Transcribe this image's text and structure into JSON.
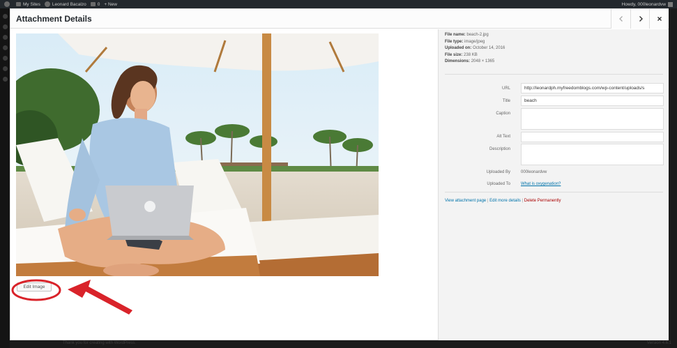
{
  "admin_bar": {
    "my_sites": "My Sites",
    "site_name": "Leonard Bacalzo",
    "comments_count": "0",
    "new_label": "+ New",
    "howdy": "Howdy, 000leonardvw"
  },
  "background": {
    "footer_left": "Thank you for creating with WordPress.",
    "footer_right": "Version 4.6.1"
  },
  "modal": {
    "title": "Attachment Details",
    "prev_icon": "chevron-left-icon",
    "next_icon": "chevron-right-icon",
    "close_icon": "close-icon"
  },
  "image": {
    "description": "Woman sitting cross-legged on a white beach lounger under a parasol, using a laptop, palm trees in background"
  },
  "edit_image_label": "Edit Image",
  "file_info": [
    {
      "label": "File name:",
      "value": "beach-2.jpg"
    },
    {
      "label": "File type:",
      "value": "image/jpeg"
    },
    {
      "label": "Uploaded on:",
      "value": "October 14, 2016"
    },
    {
      "label": "File size:",
      "value": "238 KB"
    },
    {
      "label": "Dimensions:",
      "value": "2048 × 1365"
    }
  ],
  "fields": {
    "url": {
      "label": "URL",
      "value": "http://leonardph.myfreedomblogs.com/wp-content/uploads/s"
    },
    "title": {
      "label": "Title",
      "value": "beach"
    },
    "caption": {
      "label": "Caption",
      "value": ""
    },
    "alt_text": {
      "label": "Alt Text",
      "value": ""
    },
    "description": {
      "label": "Description",
      "value": ""
    },
    "uploaded_by": {
      "label": "Uploaded By",
      "value": "000leonardvw"
    },
    "uploaded_to": {
      "label": "Uploaded To",
      "value": "What is oxygenation?"
    }
  },
  "actions": {
    "view": "View attachment page",
    "edit_more": "Edit more details",
    "delete": "Delete Permanently",
    "separator": " | "
  },
  "colors": {
    "accent_link": "#0073aa",
    "delete": "#aa0000",
    "annotation_red": "#d9232a"
  }
}
